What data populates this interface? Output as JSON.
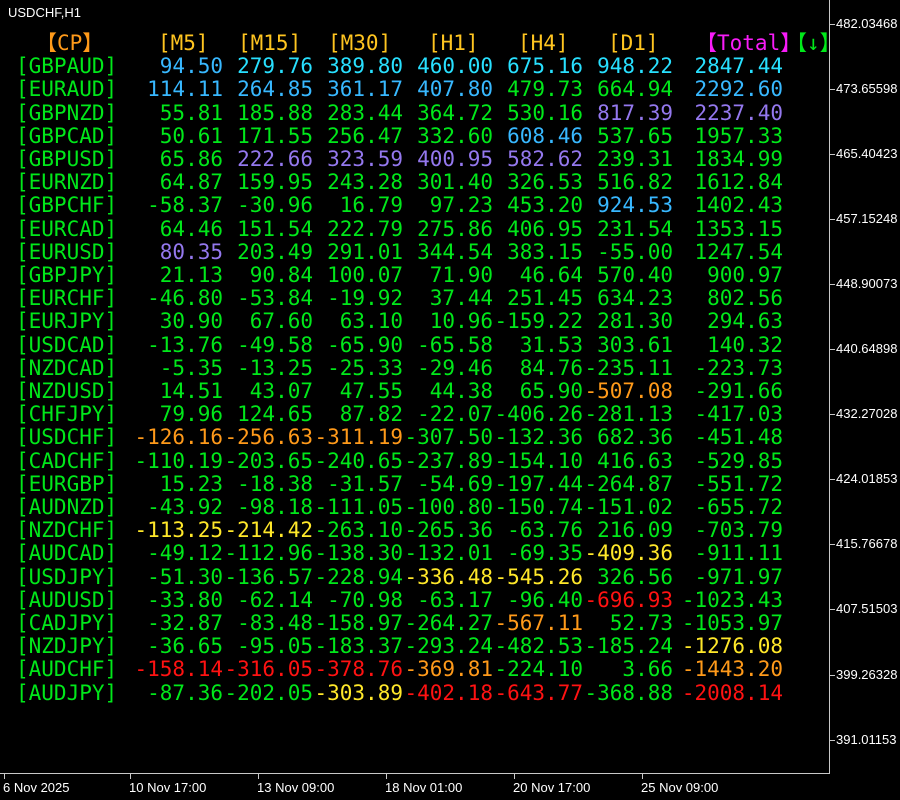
{
  "chart": {
    "title": "USDCHF,H1"
  },
  "colors": {
    "g": "#00e81a",
    "c": "#38b8ff",
    "t": "#28e0ff",
    "p": "#9478ee",
    "o": "#ff9a1a",
    "y": "#ffe82a",
    "r": "#ff1212",
    "m": "#f81cf8",
    "h": "#ffc520"
  },
  "headers": [
    {
      "label": "【CP】",
      "color": "o"
    },
    {
      "label": "[M5]",
      "color": "h"
    },
    {
      "label": "[M15]",
      "color": "h"
    },
    {
      "label": "[M30]",
      "color": "h"
    },
    {
      "label": "[H1]",
      "color": "h"
    },
    {
      "label": "[H4]",
      "color": "h"
    },
    {
      "label": "[D1]",
      "color": "h"
    },
    {
      "label": "【Total】",
      "color": "m"
    },
    {
      "label": "【↓】",
      "color": "g"
    }
  ],
  "rows": [
    {
      "pair": "[GBPAUD]",
      "vals": [
        "94.50",
        "279.76",
        "389.80",
        "460.00",
        "675.16",
        "948.22",
        "2847.44"
      ],
      "colors": [
        "c",
        "t",
        "t",
        "t",
        "t",
        "t",
        "t"
      ]
    },
    {
      "pair": "[EURAUD]",
      "vals": [
        "114.11",
        "264.85",
        "361.17",
        "407.80",
        "479.73",
        "664.94",
        "2292.60"
      ],
      "colors": [
        "c",
        "c",
        "c",
        "c",
        "g",
        "g",
        "c"
      ]
    },
    {
      "pair": "[GBPNZD]",
      "vals": [
        "55.81",
        "185.88",
        "283.44",
        "364.72",
        "530.16",
        "817.39",
        "2237.40"
      ],
      "colors": [
        "g",
        "g",
        "g",
        "g",
        "g",
        "p",
        "p"
      ]
    },
    {
      "pair": "[GBPCAD]",
      "vals": [
        "50.61",
        "171.55",
        "256.47",
        "332.60",
        "608.46",
        "537.65",
        "1957.33"
      ],
      "colors": [
        "g",
        "g",
        "g",
        "g",
        "c",
        "g",
        "g"
      ]
    },
    {
      "pair": "[GBPUSD]",
      "vals": [
        "65.86",
        "222.66",
        "323.59",
        "400.95",
        "582.62",
        "239.31",
        "1834.99"
      ],
      "colors": [
        "g",
        "p",
        "p",
        "p",
        "p",
        "g",
        "g"
      ]
    },
    {
      "pair": "[EURNZD]",
      "vals": [
        "64.87",
        "159.95",
        "243.28",
        "301.40",
        "326.53",
        "516.82",
        "1612.84"
      ],
      "colors": [
        "g",
        "g",
        "g",
        "g",
        "g",
        "g",
        "g"
      ]
    },
    {
      "pair": "[GBPCHF]",
      "vals": [
        "-58.37",
        "-30.96",
        "16.79",
        "97.23",
        "453.20",
        "924.53",
        "1402.43"
      ],
      "colors": [
        "g",
        "g",
        "g",
        "g",
        "g",
        "c",
        "g"
      ]
    },
    {
      "pair": "[EURCAD]",
      "vals": [
        "64.46",
        "151.54",
        "222.79",
        "275.86",
        "406.95",
        "231.54",
        "1353.15"
      ],
      "colors": [
        "g",
        "g",
        "g",
        "g",
        "g",
        "g",
        "g"
      ]
    },
    {
      "pair": "[EURUSD]",
      "vals": [
        "80.35",
        "203.49",
        "291.01",
        "344.54",
        "383.15",
        "-55.00",
        "1247.54"
      ],
      "colors": [
        "p",
        "g",
        "g",
        "g",
        "g",
        "g",
        "g"
      ]
    },
    {
      "pair": "[GBPJPY]",
      "vals": [
        "21.13",
        "90.84",
        "100.07",
        "71.90",
        "46.64",
        "570.40",
        "900.97"
      ],
      "colors": [
        "g",
        "g",
        "g",
        "g",
        "g",
        "g",
        "g"
      ]
    },
    {
      "pair": "[EURCHF]",
      "vals": [
        "-46.80",
        "-53.84",
        "-19.92",
        "37.44",
        "251.45",
        "634.23",
        "802.56"
      ],
      "colors": [
        "g",
        "g",
        "g",
        "g",
        "g",
        "g",
        "g"
      ]
    },
    {
      "pair": "[EURJPY]",
      "vals": [
        "30.90",
        "67.60",
        "63.10",
        "10.96",
        "-159.22",
        "281.30",
        "294.63"
      ],
      "colors": [
        "g",
        "g",
        "g",
        "g",
        "g",
        "g",
        "g"
      ]
    },
    {
      "pair": "[USDCAD]",
      "vals": [
        "-13.76",
        "-49.58",
        "-65.90",
        "-65.58",
        "31.53",
        "303.61",
        "140.32"
      ],
      "colors": [
        "g",
        "g",
        "g",
        "g",
        "g",
        "g",
        "g"
      ]
    },
    {
      "pair": "[NZDCAD]",
      "vals": [
        "-5.35",
        "-13.25",
        "-25.33",
        "-29.46",
        "84.76",
        "-235.11",
        "-223.73"
      ],
      "colors": [
        "g",
        "g",
        "g",
        "g",
        "g",
        "g",
        "g"
      ]
    },
    {
      "pair": "[NZDUSD]",
      "vals": [
        "14.51",
        "43.07",
        "47.55",
        "44.38",
        "65.90",
        "-507.08",
        "-291.66"
      ],
      "colors": [
        "g",
        "g",
        "g",
        "g",
        "g",
        "o",
        "g"
      ]
    },
    {
      "pair": "[CHFJPY]",
      "vals": [
        "79.96",
        "124.65",
        "87.82",
        "-22.07",
        "-406.26",
        "-281.13",
        "-417.03"
      ],
      "colors": [
        "g",
        "g",
        "g",
        "g",
        "g",
        "g",
        "g"
      ]
    },
    {
      "pair": "[USDCHF]",
      "vals": [
        "-126.16",
        "-256.63",
        "-311.19",
        "-307.50",
        "-132.36",
        "682.36",
        "-451.48"
      ],
      "colors": [
        "o",
        "o",
        "o",
        "g",
        "g",
        "g",
        "g"
      ]
    },
    {
      "pair": "[CADCHF]",
      "vals": [
        "-110.19",
        "-203.65",
        "-240.65",
        "-237.89",
        "-154.10",
        "416.63",
        "-529.85"
      ],
      "colors": [
        "g",
        "g",
        "g",
        "g",
        "g",
        "g",
        "g"
      ]
    },
    {
      "pair": "[EURGBP]",
      "vals": [
        "15.23",
        "-18.38",
        "-31.57",
        "-54.69",
        "-197.44",
        "-264.87",
        "-551.72"
      ],
      "colors": [
        "g",
        "g",
        "g",
        "g",
        "g",
        "g",
        "g"
      ]
    },
    {
      "pair": "[AUDNZD]",
      "vals": [
        "-43.92",
        "-98.18",
        "-111.05",
        "-100.80",
        "-150.74",
        "-151.02",
        "-655.72"
      ],
      "colors": [
        "g",
        "g",
        "g",
        "g",
        "g",
        "g",
        "g"
      ]
    },
    {
      "pair": "[NZDCHF]",
      "vals": [
        "-113.25",
        "-214.42",
        "-263.10",
        "-265.36",
        "-63.76",
        "216.09",
        "-703.79"
      ],
      "colors": [
        "y",
        "y",
        "g",
        "g",
        "g",
        "g",
        "g"
      ]
    },
    {
      "pair": "[AUDCAD]",
      "vals": [
        "-49.12",
        "-112.96",
        "-138.30",
        "-132.01",
        "-69.35",
        "-409.36",
        "-911.11"
      ],
      "colors": [
        "g",
        "g",
        "g",
        "g",
        "g",
        "y",
        "g"
      ]
    },
    {
      "pair": "[USDJPY]",
      "vals": [
        "-51.30",
        "-136.57",
        "-228.94",
        "-336.48",
        "-545.26",
        "326.56",
        "-971.97"
      ],
      "colors": [
        "g",
        "g",
        "g",
        "y",
        "y",
        "g",
        "g"
      ]
    },
    {
      "pair": "[AUDUSD]",
      "vals": [
        "-33.80",
        "-62.14",
        "-70.98",
        "-63.17",
        "-96.40",
        "-696.93",
        "-1023.43"
      ],
      "colors": [
        "g",
        "g",
        "g",
        "g",
        "g",
        "r",
        "g"
      ]
    },
    {
      "pair": "[CADJPY]",
      "vals": [
        "-32.87",
        "-83.48",
        "-158.97",
        "-264.27",
        "-567.11",
        "52.73",
        "-1053.97"
      ],
      "colors": [
        "g",
        "g",
        "g",
        "g",
        "o",
        "g",
        "g"
      ]
    },
    {
      "pair": "[NZDJPY]",
      "vals": [
        "-36.65",
        "-95.05",
        "-183.37",
        "-293.24",
        "-482.53",
        "-185.24",
        "-1276.08"
      ],
      "colors": [
        "g",
        "g",
        "g",
        "g",
        "g",
        "g",
        "y"
      ]
    },
    {
      "pair": "[AUDCHF]",
      "vals": [
        "-158.14",
        "-316.05",
        "-378.76",
        "-369.81",
        "-224.10",
        "3.66",
        "-1443.20"
      ],
      "colors": [
        "r",
        "r",
        "r",
        "o",
        "g",
        "g",
        "o"
      ]
    },
    {
      "pair": "[AUDJPY]",
      "vals": [
        "-87.36",
        "-202.05",
        "-303.89",
        "-402.18",
        "-643.77",
        "-368.88",
        "-2008.14"
      ],
      "colors": [
        "g",
        "g",
        "y",
        "r",
        "r",
        "g",
        "r"
      ]
    }
  ],
  "price_axis": [
    "482.03468",
    "473.65598",
    "465.40423",
    "457.15248",
    "448.90073",
    "440.64898",
    "432.27028",
    "424.01853",
    "415.76678",
    "407.51503",
    "399.26328",
    "391.01153"
  ],
  "time_axis": [
    "6 Nov 2025",
    "10 Nov 17:00",
    "13 Nov 09:00",
    "18 Nov 01:00",
    "20 Nov 17:00",
    "25 Nov 09:00"
  ]
}
